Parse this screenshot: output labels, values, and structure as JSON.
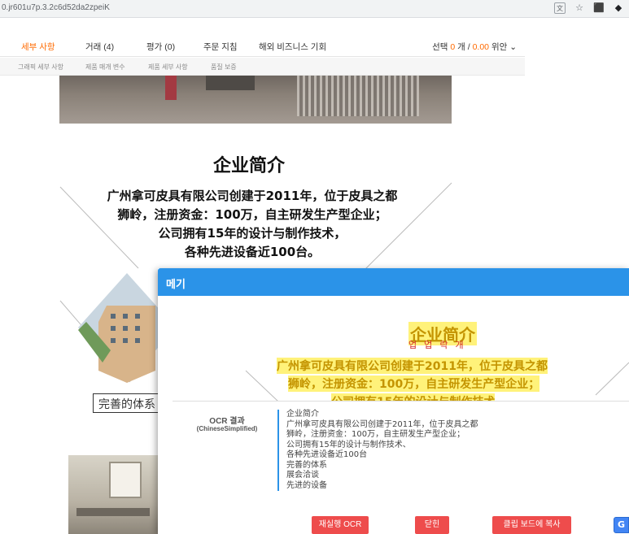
{
  "browser": {
    "url": "0.jr601u7p.3.2c6d52da2zpeiK",
    "icons": [
      "translate-icon",
      "star-icon",
      "pdf-icon",
      "extension-icon"
    ]
  },
  "tabs": {
    "items": [
      {
        "label": "세부 사항",
        "active": true
      },
      {
        "label": "거래 (4)"
      },
      {
        "label": "평가 (0)"
      },
      {
        "label": "주문 지침"
      },
      {
        "label": "해외 비즈니스 기회"
      }
    ],
    "summary": {
      "prefix": "선택",
      "count": "0",
      "unit": "개 /",
      "price": "0.00",
      "currency": "위안"
    }
  },
  "subtabs": [
    "그래픽 세부 사항",
    "제품 매개 변수",
    "제품 세부 사항",
    "품질 보증"
  ],
  "content": {
    "title": "企业简介",
    "intro": [
      "广州拿可皮具有限公司创建于2011年，位于皮具之都",
      "狮岭，注册资金：100万，自主研发生产型企业；",
      "公司拥有15年的设计与制作技术，",
      "各种先进设备近100台。"
    ],
    "features_label": "完善的体系"
  },
  "dialog": {
    "title": "메기",
    "preview": {
      "title": "企业简介",
      "line1": "广州拿可皮具有限公司创建于2011年，位于皮具之都",
      "line2": "狮岭，注册资金：100万，自主研发生产型企业；",
      "line3": "公司拥有15年的设计与制作技术"
    },
    "ocr_label": "OCR 결과",
    "ocr_lang": "(ChineseSimplified)",
    "ocr_lines": [
      "企业简介",
      "广州拿可皮具有限公司创建于2011年，位于皮具之都",
      "狮岭，注册资金：100万，自主研发生产型企业；",
      "公司拥有15年的设计与制作技术、",
      "各种先进设备近100台",
      "完善的体系",
      "展会洽谈",
      "先进的设备"
    ],
    "buttons": {
      "reocr": "재실행 OCR",
      "close": "닫힌",
      "copy": "클립 보드에 복사"
    }
  },
  "google_translate": "G",
  "colors": {
    "accent": "#ff6a00",
    "dialog_header": "#2b93e8",
    "button": "#ee4c4c",
    "highlight": "#fff27a"
  }
}
